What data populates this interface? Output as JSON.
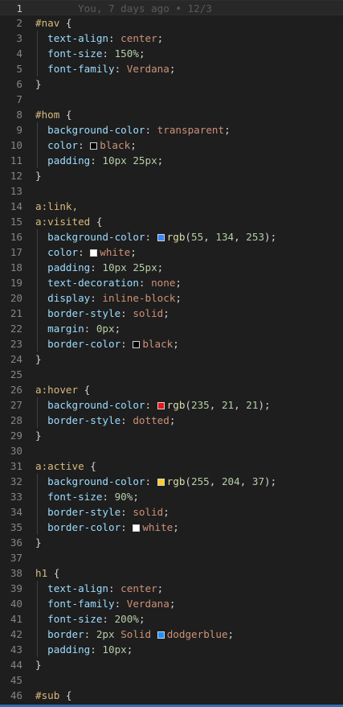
{
  "editor": {
    "blame": "You, 7 days ago • 12/3",
    "lines": [
      {
        "n": "1"
      },
      {
        "n": "2",
        "tokens": [
          {
            "t": "#nav",
            "c": "sel"
          },
          {
            "t": " {",
            "c": "punc"
          }
        ]
      },
      {
        "n": "3",
        "tokens": [
          {
            "t": "  "
          },
          {
            "t": "text-align",
            "c": "prop"
          },
          {
            "t": ": ",
            "c": "punc"
          },
          {
            "t": "center",
            "c": "val"
          },
          {
            "t": ";",
            "c": "punc"
          }
        ]
      },
      {
        "n": "4",
        "tokens": [
          {
            "t": "  "
          },
          {
            "t": "font-size",
            "c": "prop"
          },
          {
            "t": ": ",
            "c": "punc"
          },
          {
            "t": "150%",
            "c": "num"
          },
          {
            "t": ";",
            "c": "punc"
          }
        ]
      },
      {
        "n": "5",
        "tokens": [
          {
            "t": "  "
          },
          {
            "t": "font-family",
            "c": "prop"
          },
          {
            "t": ": ",
            "c": "punc"
          },
          {
            "t": "Verdana",
            "c": "val"
          },
          {
            "t": ";",
            "c": "punc"
          }
        ]
      },
      {
        "n": "6",
        "tokens": [
          {
            "t": "}",
            "c": "punc"
          }
        ]
      },
      {
        "n": "7"
      },
      {
        "n": "8",
        "tokens": [
          {
            "t": "#hom",
            "c": "sel"
          },
          {
            "t": " {",
            "c": "punc"
          }
        ]
      },
      {
        "n": "9",
        "tokens": [
          {
            "t": "  "
          },
          {
            "t": "background-color",
            "c": "prop"
          },
          {
            "t": ": ",
            "c": "punc"
          },
          {
            "t": "transparent",
            "c": "val"
          },
          {
            "t": ";",
            "c": "punc"
          }
        ]
      },
      {
        "n": "10",
        "tokens": [
          {
            "t": "  "
          },
          {
            "t": "color",
            "c": "prop"
          },
          {
            "t": ": ",
            "c": "punc"
          },
          {
            "sw": "#000000"
          },
          {
            "t": "black",
            "c": "val"
          },
          {
            "t": ";",
            "c": "punc"
          }
        ]
      },
      {
        "n": "11",
        "tokens": [
          {
            "t": "  "
          },
          {
            "t": "padding",
            "c": "prop"
          },
          {
            "t": ": ",
            "c": "punc"
          },
          {
            "t": "10px 25px",
            "c": "num"
          },
          {
            "t": ";",
            "c": "punc"
          }
        ]
      },
      {
        "n": "12",
        "tokens": [
          {
            "t": "}",
            "c": "punc"
          }
        ]
      },
      {
        "n": "13"
      },
      {
        "n": "14",
        "tokens": [
          {
            "t": "a",
            "c": "tag"
          },
          {
            "t": ":link,",
            "c": "sel"
          }
        ]
      },
      {
        "n": "15",
        "tokens": [
          {
            "t": "a",
            "c": "tag"
          },
          {
            "t": ":visited",
            "c": "sel"
          },
          {
            "t": " {",
            "c": "punc"
          }
        ]
      },
      {
        "n": "16",
        "tokens": [
          {
            "t": "  "
          },
          {
            "t": "background-color",
            "c": "prop"
          },
          {
            "t": ": ",
            "c": "punc"
          },
          {
            "sw": "#3786fd"
          },
          {
            "t": "rgb",
            "c": "fn"
          },
          {
            "t": "(",
            "c": "punc"
          },
          {
            "t": "55",
            "c": "num"
          },
          {
            "t": ", ",
            "c": "punc"
          },
          {
            "t": "134",
            "c": "num"
          },
          {
            "t": ", ",
            "c": "punc"
          },
          {
            "t": "253",
            "c": "num"
          },
          {
            "t": ");",
            "c": "punc"
          }
        ]
      },
      {
        "n": "17",
        "tokens": [
          {
            "t": "  "
          },
          {
            "t": "color",
            "c": "prop"
          },
          {
            "t": ": ",
            "c": "punc"
          },
          {
            "sw": "#ffffff"
          },
          {
            "t": "white",
            "c": "val"
          },
          {
            "t": ";",
            "c": "punc"
          }
        ]
      },
      {
        "n": "18",
        "tokens": [
          {
            "t": "  "
          },
          {
            "t": "padding",
            "c": "prop"
          },
          {
            "t": ": ",
            "c": "punc"
          },
          {
            "t": "10px 25px",
            "c": "num"
          },
          {
            "t": ";",
            "c": "punc"
          }
        ]
      },
      {
        "n": "19",
        "tokens": [
          {
            "t": "  "
          },
          {
            "t": "text-decoration",
            "c": "prop"
          },
          {
            "t": ": ",
            "c": "punc"
          },
          {
            "t": "none",
            "c": "val"
          },
          {
            "t": ";",
            "c": "punc"
          }
        ]
      },
      {
        "n": "20",
        "tokens": [
          {
            "t": "  "
          },
          {
            "t": "display",
            "c": "prop"
          },
          {
            "t": ": ",
            "c": "punc"
          },
          {
            "t": "inline-block",
            "c": "val"
          },
          {
            "t": ";",
            "c": "punc"
          }
        ]
      },
      {
        "n": "21",
        "tokens": [
          {
            "t": "  "
          },
          {
            "t": "border-style",
            "c": "prop"
          },
          {
            "t": ": ",
            "c": "punc"
          },
          {
            "t": "solid",
            "c": "val"
          },
          {
            "t": ";",
            "c": "punc"
          }
        ]
      },
      {
        "n": "22",
        "tokens": [
          {
            "t": "  "
          },
          {
            "t": "margin",
            "c": "prop"
          },
          {
            "t": ": ",
            "c": "punc"
          },
          {
            "t": "0px",
            "c": "num"
          },
          {
            "t": ";",
            "c": "punc"
          }
        ]
      },
      {
        "n": "23",
        "tokens": [
          {
            "t": "  "
          },
          {
            "t": "border-color",
            "c": "prop"
          },
          {
            "t": ": ",
            "c": "punc"
          },
          {
            "sw": "#000000"
          },
          {
            "t": "black",
            "c": "val"
          },
          {
            "t": ";",
            "c": "punc"
          }
        ]
      },
      {
        "n": "24",
        "tokens": [
          {
            "t": "}",
            "c": "punc"
          }
        ]
      },
      {
        "n": "25"
      },
      {
        "n": "26",
        "tokens": [
          {
            "t": "a",
            "c": "tag"
          },
          {
            "t": ":hover",
            "c": "sel"
          },
          {
            "t": " {",
            "c": "punc"
          }
        ]
      },
      {
        "n": "27",
        "tokens": [
          {
            "t": "  "
          },
          {
            "t": "background-color",
            "c": "prop"
          },
          {
            "t": ": ",
            "c": "punc"
          },
          {
            "sw": "#eb1515"
          },
          {
            "t": "rgb",
            "c": "fn"
          },
          {
            "t": "(",
            "c": "punc"
          },
          {
            "t": "235",
            "c": "num"
          },
          {
            "t": ", ",
            "c": "punc"
          },
          {
            "t": "21",
            "c": "num"
          },
          {
            "t": ", ",
            "c": "punc"
          },
          {
            "t": "21",
            "c": "num"
          },
          {
            "t": ");",
            "c": "punc"
          }
        ]
      },
      {
        "n": "28",
        "tokens": [
          {
            "t": "  "
          },
          {
            "t": "border-style",
            "c": "prop"
          },
          {
            "t": ": ",
            "c": "punc"
          },
          {
            "t": "dotted",
            "c": "val"
          },
          {
            "t": ";",
            "c": "punc"
          }
        ]
      },
      {
        "n": "29",
        "tokens": [
          {
            "t": "}",
            "c": "punc"
          }
        ]
      },
      {
        "n": "30"
      },
      {
        "n": "31",
        "tokens": [
          {
            "t": "a",
            "c": "tag"
          },
          {
            "t": ":active",
            "c": "sel"
          },
          {
            "t": " {",
            "c": "punc"
          }
        ]
      },
      {
        "n": "32",
        "tokens": [
          {
            "t": "  "
          },
          {
            "t": "background-color",
            "c": "prop"
          },
          {
            "t": ": ",
            "c": "punc"
          },
          {
            "sw": "#ffcc25"
          },
          {
            "t": "rgb",
            "c": "fn"
          },
          {
            "t": "(",
            "c": "punc"
          },
          {
            "t": "255",
            "c": "num"
          },
          {
            "t": ", ",
            "c": "punc"
          },
          {
            "t": "204",
            "c": "num"
          },
          {
            "t": ", ",
            "c": "punc"
          },
          {
            "t": "37",
            "c": "num"
          },
          {
            "t": ");",
            "c": "punc"
          }
        ]
      },
      {
        "n": "33",
        "tokens": [
          {
            "t": "  "
          },
          {
            "t": "font-size",
            "c": "prop"
          },
          {
            "t": ": ",
            "c": "punc"
          },
          {
            "t": "90%",
            "c": "num"
          },
          {
            "t": ";",
            "c": "punc"
          }
        ]
      },
      {
        "n": "34",
        "tokens": [
          {
            "t": "  "
          },
          {
            "t": "border-style",
            "c": "prop"
          },
          {
            "t": ": ",
            "c": "punc"
          },
          {
            "t": "solid",
            "c": "val"
          },
          {
            "t": ";",
            "c": "punc"
          }
        ]
      },
      {
        "n": "35",
        "tokens": [
          {
            "t": "  "
          },
          {
            "t": "border-color",
            "c": "prop"
          },
          {
            "t": ": ",
            "c": "punc"
          },
          {
            "sw": "#ffffff"
          },
          {
            "t": "white",
            "c": "val"
          },
          {
            "t": ";",
            "c": "punc"
          }
        ]
      },
      {
        "n": "36",
        "tokens": [
          {
            "t": "}",
            "c": "punc"
          }
        ]
      },
      {
        "n": "37"
      },
      {
        "n": "38",
        "tokens": [
          {
            "t": "h1",
            "c": "tag"
          },
          {
            "t": " {",
            "c": "punc"
          }
        ]
      },
      {
        "n": "39",
        "tokens": [
          {
            "t": "  "
          },
          {
            "t": "text-align",
            "c": "prop"
          },
          {
            "t": ": ",
            "c": "punc"
          },
          {
            "t": "center",
            "c": "val"
          },
          {
            "t": ";",
            "c": "punc"
          }
        ]
      },
      {
        "n": "40",
        "tokens": [
          {
            "t": "  "
          },
          {
            "t": "font-family",
            "c": "prop"
          },
          {
            "t": ": ",
            "c": "punc"
          },
          {
            "t": "Verdana",
            "c": "val"
          },
          {
            "t": ";",
            "c": "punc"
          }
        ]
      },
      {
        "n": "41",
        "tokens": [
          {
            "t": "  "
          },
          {
            "t": "font-size",
            "c": "prop"
          },
          {
            "t": ": ",
            "c": "punc"
          },
          {
            "t": "200%",
            "c": "num"
          },
          {
            "t": ";",
            "c": "punc"
          }
        ]
      },
      {
        "n": "42",
        "tokens": [
          {
            "t": "  "
          },
          {
            "t": "border",
            "c": "prop"
          },
          {
            "t": ": ",
            "c": "punc"
          },
          {
            "t": "2px",
            "c": "num"
          },
          {
            "t": " "
          },
          {
            "t": "Solid",
            "c": "val"
          },
          {
            "t": " "
          },
          {
            "sw": "#1e90ff"
          },
          {
            "t": "dodgerblue",
            "c": "val"
          },
          {
            "t": ";",
            "c": "punc"
          }
        ]
      },
      {
        "n": "43",
        "tokens": [
          {
            "t": "  "
          },
          {
            "t": "padding",
            "c": "prop"
          },
          {
            "t": ": ",
            "c": "punc"
          },
          {
            "t": "10px",
            "c": "num"
          },
          {
            "t": ";",
            "c": "punc"
          }
        ]
      },
      {
        "n": "44",
        "tokens": [
          {
            "t": "}",
            "c": "punc"
          }
        ]
      },
      {
        "n": "45"
      },
      {
        "n": "46",
        "tokens": [
          {
            "t": "#sub",
            "c": "sel"
          },
          {
            "t": " {",
            "c": "punc"
          }
        ]
      }
    ]
  }
}
